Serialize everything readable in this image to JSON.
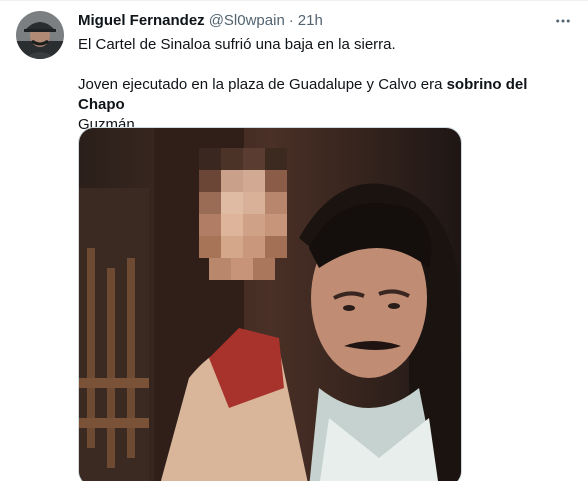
{
  "author": {
    "display_name": "Miguel Fernandez",
    "handle": "@Sl0wpain",
    "separator": "·",
    "timestamp": "21h"
  },
  "tweet": {
    "line1": "El Cartel de Sinaloa sufrió una baja en la sierra.",
    "line2_prefix": "Joven ejecutado en la plaza de Guadalupe y Calvo era ",
    "line2_bold": "sobrino del Chapo",
    "line3": "Guzmán"
  },
  "icons": {
    "more": "more-dots-icon",
    "avatar": "user-avatar-photo",
    "media": "tweet-photo"
  },
  "colors": {
    "text": "#0f1419",
    "secondary": "#536471",
    "border": "#cfd9de"
  }
}
